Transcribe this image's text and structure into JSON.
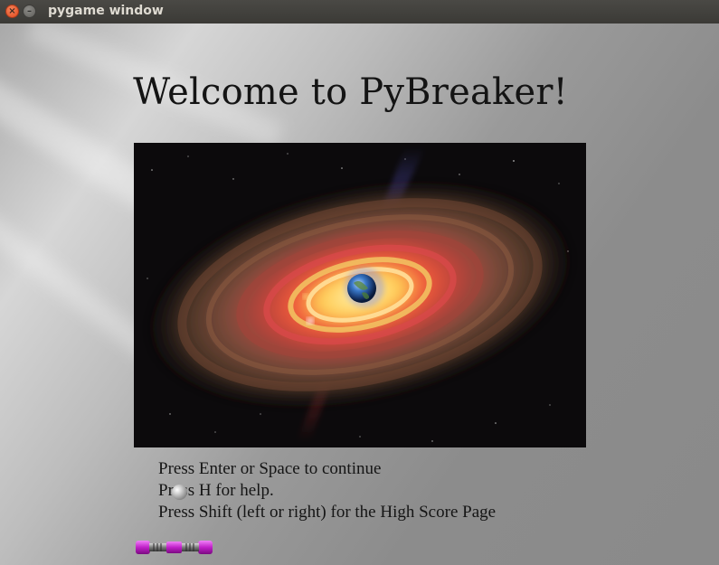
{
  "window": {
    "title": "pygame window",
    "close_glyph": "×",
    "minimize_glyph": "–"
  },
  "game": {
    "heading": "Welcome to PyBreaker!",
    "splash_image": "galaxy-with-earth-image",
    "instructions": [
      "Press Enter or Space to continue",
      "Press H for help.",
      "Press Shift (left or right) for the High Score Page"
    ],
    "ball_icon": "ball",
    "paddle_icon": "paddle"
  },
  "colors": {
    "background": "#9a9a9a",
    "text": "#151515",
    "paddle": "#c020c8"
  }
}
